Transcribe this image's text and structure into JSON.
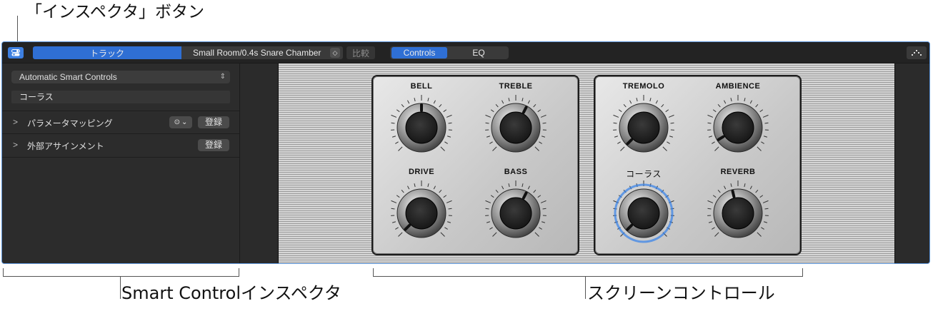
{
  "annotations": {
    "inspector_button": "「インスペクタ」ボタン",
    "smart_control_inspector": "Smart Controlインスペクタ",
    "screen_controls": "スクリーンコントロール"
  },
  "toolbar": {
    "inspector_icon": "inspector-icon",
    "track_tab": "トラック",
    "preset": "Small Room/0.4s Snare Chamber",
    "compare": "比較",
    "tabs": [
      {
        "label": "Controls",
        "active": true
      },
      {
        "label": "EQ",
        "active": false
      }
    ],
    "accent_color": "#2f6fd4"
  },
  "inspector": {
    "smart_control_select": "Automatic Smart Controls",
    "selected_parameter": "コーラス",
    "sections": [
      {
        "label": "パラメータマッピング",
        "button": "登録",
        "has_menu": true
      },
      {
        "label": "外部アサインメント",
        "button": "登録",
        "has_menu": false
      }
    ]
  },
  "screen_controls": {
    "panels": [
      {
        "knobs": [
          {
            "label": "BELL",
            "value": 0.5,
            "highlighted": false
          },
          {
            "label": "TREBLE",
            "value": 0.6,
            "highlighted": false
          },
          {
            "label": "DRIVE",
            "value": 0.0,
            "highlighted": false
          },
          {
            "label": "BASS",
            "value": 0.6,
            "highlighted": false
          }
        ]
      },
      {
        "knobs": [
          {
            "label": "TREMOLO",
            "value": 0.0,
            "highlighted": false
          },
          {
            "label": "AMBIENCE",
            "value": 0.05,
            "highlighted": false
          },
          {
            "label": "コーラス",
            "value": 0.0,
            "highlighted": true
          },
          {
            "label": "REVERB",
            "value": 0.45,
            "highlighted": false
          }
        ]
      }
    ],
    "highlight_color": "#3d86e8"
  }
}
